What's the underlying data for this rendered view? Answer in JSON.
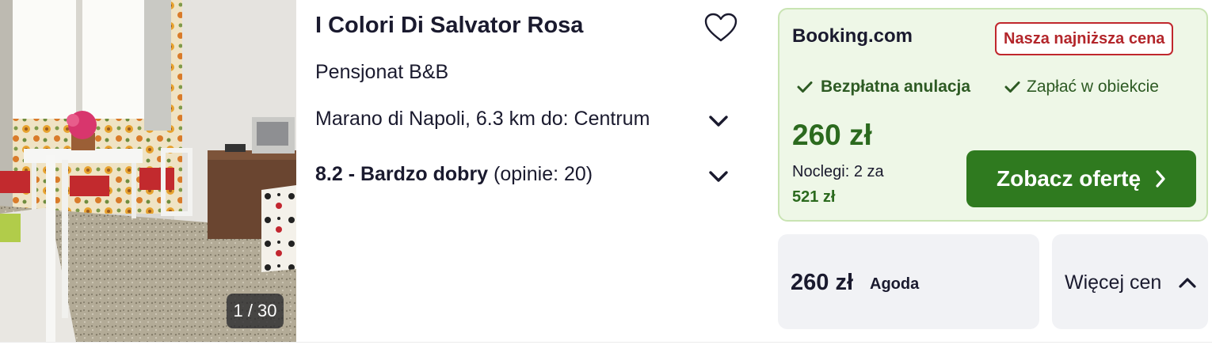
{
  "hotel": {
    "name": "I Colori Di Salvator Rosa",
    "type": "Pensjonat B&B",
    "location": "Marano di Napoli, 6.3 km do: Centrum",
    "rating_score_label": "8.2 - Bardzo dobry",
    "rating_reviews": "(opinie: 20)",
    "photo_counter": "1 / 30"
  },
  "icons": {
    "favorite": "heart-outline-icon",
    "expand": "chevron-down-icon",
    "check": "check-icon",
    "next": "chevron-right-icon",
    "collapse": "chevron-up-icon"
  },
  "offer": {
    "provider": "Booking.com",
    "badge": "Nasza najniższa cena",
    "feature_1": "Bezpłatna anulacja",
    "feature_2": "Zapłać w obiekcie",
    "price": "260 zł",
    "nights": "Noclegi: 2 za",
    "total": "521 zł",
    "cta_label": "Zobacz ofertę"
  },
  "alt_offer": {
    "price": "260 zł",
    "provider": "Agoda"
  },
  "more_prices": {
    "label": "Więcej cen"
  },
  "colors": {
    "accent_green": "#2f7a1f",
    "price_green": "#2b6a1e",
    "offer_bg": "#eef7e7",
    "badge_red": "#b3262b"
  }
}
